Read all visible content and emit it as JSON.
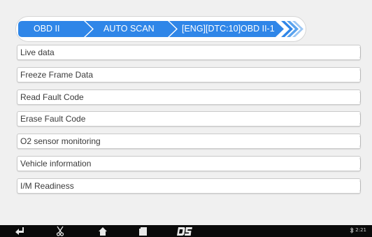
{
  "breadcrumb": {
    "items": [
      "OBD II",
      "AUTO SCAN",
      "[ENG][DTC:10]OBD II-1"
    ],
    "accent_color": "#2f86e8",
    "light_color": "#ffffff"
  },
  "menu": {
    "items": [
      "Live data",
      "Freeze Frame Data",
      "Read Fault Code",
      "Erase Fault Code",
      "O2 sensor monitoring",
      "Vehicle information",
      "I/M Readiness"
    ]
  },
  "navbar": {
    "icons": [
      "back-icon",
      "scissors-icon",
      "home-icon",
      "document-icon",
      "ds-logo-icon"
    ],
    "clock": "2:21",
    "status_icon": "bluetooth-icon"
  }
}
